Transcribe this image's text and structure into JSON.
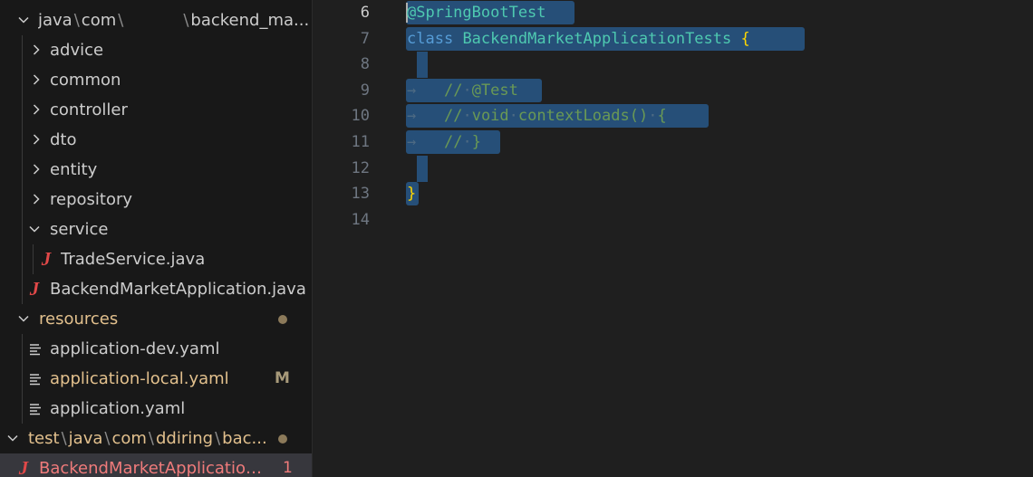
{
  "explorer": {
    "rows": [
      {
        "parts": [
          "java",
          "com",
          "",
          "backend_ma..."
        ]
      },
      {
        "label": "advice"
      },
      {
        "label": "common"
      },
      {
        "label": "controller"
      },
      {
        "label": "dto"
      },
      {
        "label": "entity"
      },
      {
        "label": "repository"
      },
      {
        "label": "service"
      },
      {
        "label": "TradeService.java",
        "icon": "J"
      },
      {
        "label": "BackendMarketApplication.java",
        "icon": "J"
      },
      {
        "label": "resources"
      },
      {
        "label": "application-dev.yaml"
      },
      {
        "label": "application-local.yaml",
        "badge": "M"
      },
      {
        "label": "application.yaml"
      },
      {
        "parts": [
          "test",
          "java",
          "com",
          "ddiring",
          "bac..."
        ]
      },
      {
        "label": "BackendMarketApplicationT...",
        "icon": "J",
        "badge": "1"
      }
    ],
    "path_separator": "\\"
  },
  "editor": {
    "lines": [
      {
        "number": "6",
        "tokens": [
          "@SpringBootTest"
        ]
      },
      {
        "number": "7",
        "tokens": [
          "class",
          " ",
          "BackendMarketApplicationTests",
          " ",
          "{"
        ]
      },
      {
        "number": "8",
        "tokens": []
      },
      {
        "number": "9",
        "tokens": [
          "→",
          "   ",
          "//",
          "·",
          "@Test"
        ]
      },
      {
        "number": "10",
        "tokens": [
          "→",
          "   ",
          "//",
          "·",
          "void",
          "·",
          "contextLoads()",
          "·",
          "{"
        ]
      },
      {
        "number": "11",
        "tokens": [
          "→",
          "   ",
          "//",
          "·",
          "}"
        ]
      },
      {
        "number": "12",
        "tokens": []
      },
      {
        "number": "13",
        "tokens": [
          "}"
        ]
      },
      {
        "number": "14",
        "tokens": []
      }
    ]
  },
  "colors": {
    "sidebar_bg": "#181818",
    "editor_bg": "#1f1f1f",
    "selection": "#264f78",
    "modified": "#e2c08d",
    "error": "#f07b7b",
    "java_icon": "#e04848"
  }
}
